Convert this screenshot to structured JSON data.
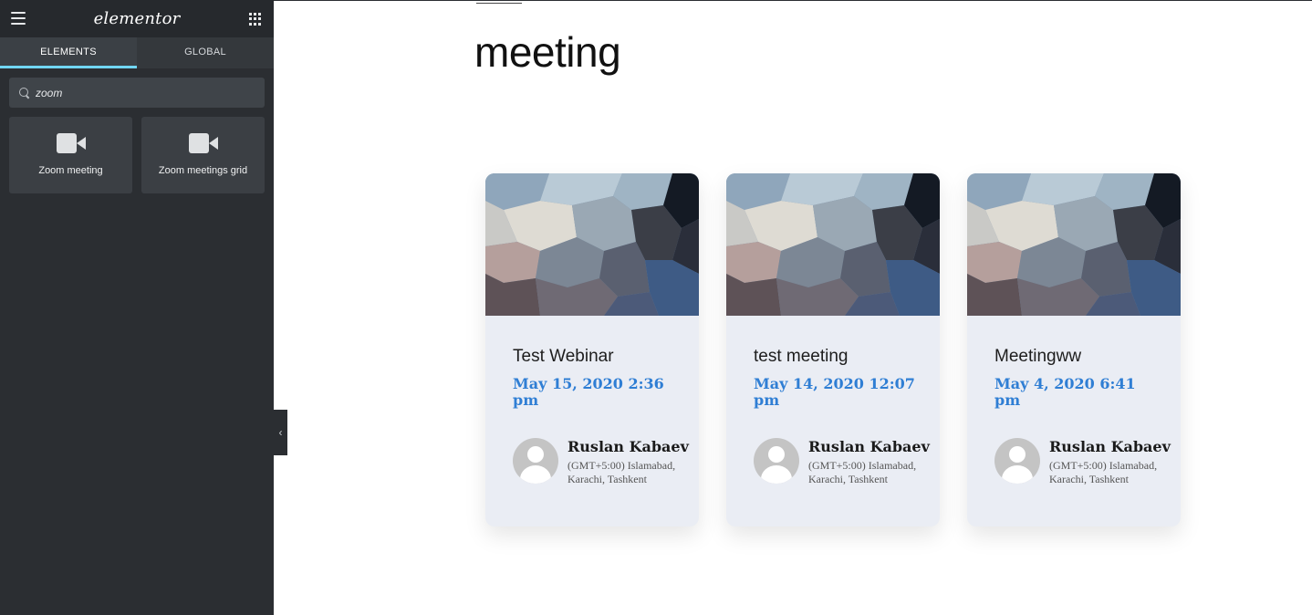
{
  "sidebar": {
    "logo": "elementor",
    "tabs": [
      {
        "label": "ELEMENTS",
        "active": true
      },
      {
        "label": "GLOBAL",
        "active": false
      }
    ],
    "search": {
      "value": "zoom",
      "placeholder": "Search Widget..."
    },
    "widgets": [
      {
        "label": "Zoom meeting",
        "icon": "video-camera-icon"
      },
      {
        "label": "Zoom meetings grid",
        "icon": "video-camera-icon"
      }
    ],
    "accent_color": "#71d7f7"
  },
  "main": {
    "title": "meeting",
    "date_color": "#2f7ed4",
    "cards": [
      {
        "title": "Test Webinar",
        "date": "May 15, 2020 2:36 pm",
        "host": "Ruslan Kabaev",
        "timezone": "(GMT+5:00) Islamabad, Karachi, Tashkent"
      },
      {
        "title": "test meeting",
        "date": "May 14, 2020 12:07 pm",
        "host": "Ruslan Kabaev",
        "timezone": "(GMT+5:00) Islamabad, Karachi, Tashkent"
      },
      {
        "title": "Meetingww",
        "date": "May 4, 2020 6:41 pm",
        "host": "Ruslan Kabaev",
        "timezone": "(GMT+5:00) Islamabad, Karachi, Tashkent"
      }
    ]
  }
}
